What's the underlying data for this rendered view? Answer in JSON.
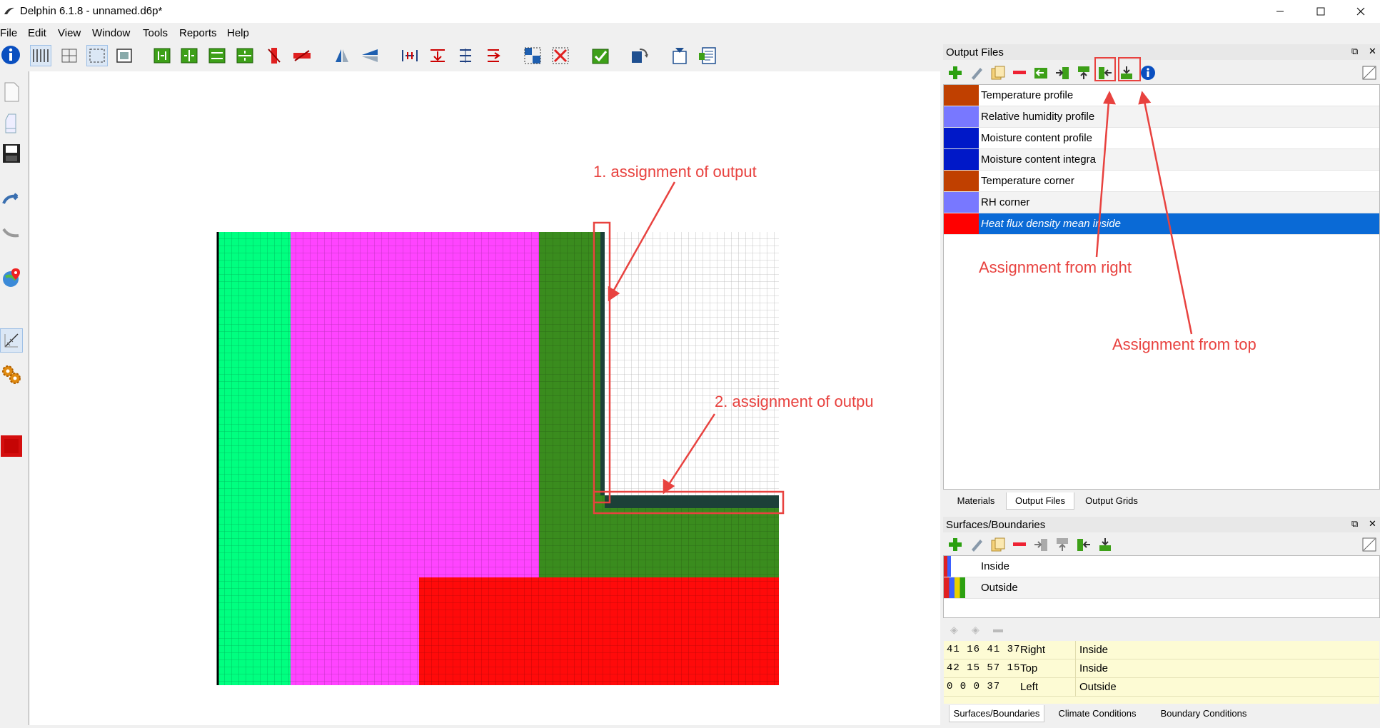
{
  "window": {
    "title": "Delphin 6.1.8 - unnamed.d6p*",
    "controls": [
      "minimize",
      "maximize",
      "close"
    ]
  },
  "menu": [
    "File",
    "Edit",
    "View",
    "Window",
    "Tools",
    "Reports",
    "Help"
  ],
  "toolbar_icons": [
    "info-icon",
    "grid-columns-icon",
    "grid-split-icon",
    "grid-select-icon",
    "fit-view-icon",
    "insert-column-icon",
    "split-column-icon",
    "insert-row-icon",
    "split-row-icon",
    "delete-column-icon",
    "delete-row-icon",
    "mirror-vertical-icon",
    "mirror-horizontal-icon",
    "merge-columns-icon",
    "merge-rows-icon",
    "distribute-columns-icon",
    "distribute-rows-icon",
    "select-region-icon",
    "delete-region-icon",
    "check-icon",
    "rotate-icon",
    "export-icon",
    "report-icon"
  ],
  "sidebar_icons": [
    "new-file-icon",
    "open-file-icon",
    "save-icon",
    "link-icon",
    "unlink-icon",
    "location-icon",
    "geometry-icon",
    "settings-icon",
    "simulation-icon"
  ],
  "annotations": {
    "first": "1. assignment of output",
    "second": "2. assignment of outpu",
    "right": "Assignment from right",
    "top": "Assignment from top"
  },
  "output_files": {
    "title": "Output Files",
    "items": [
      {
        "label": "Temperature profile",
        "color": "#c04000"
      },
      {
        "label": "Relative humidity profile",
        "color": "#7878ff"
      },
      {
        "label": "Moisture content profile",
        "color": "#0018c8"
      },
      {
        "label": "Moisture content integra",
        "color": "#0018c8"
      },
      {
        "label": "Temperature corner",
        "color": "#c04000"
      },
      {
        "label": "RH corner",
        "color": "#7878ff"
      },
      {
        "label": "Heat flux density mean inside",
        "color": "#ff0000"
      }
    ],
    "tabs": [
      "Materials",
      "Output Files",
      "Output Grids"
    ],
    "active_tab": "Output Files"
  },
  "surfaces": {
    "title": "Surfaces/Boundaries",
    "items": [
      {
        "label": "Inside"
      },
      {
        "label": "Outside"
      }
    ],
    "assignments": [
      {
        "nums": "41 16 41 37",
        "dir": "Right",
        "surface": "Inside"
      },
      {
        "nums": "42 15 57 15",
        "dir": "Top",
        "surface": "Inside"
      },
      {
        "nums": "0 0 0 37",
        "dir": "Left",
        "surface": "Outside"
      }
    ],
    "tabs": [
      "Surfaces/Boundaries",
      "Climate Conditions",
      "Boundary Conditions"
    ],
    "active_tab": "Surfaces/Boundaries"
  },
  "colors": {
    "layer_mint": "#00ff80",
    "layer_magenta": "#ff44ff",
    "layer_green": "#3a8c1e",
    "layer_red": "#ff0a0a",
    "selection_dark": "#1c4038",
    "annotation": "#e8423f",
    "selection_row": "#0a6ad6"
  }
}
